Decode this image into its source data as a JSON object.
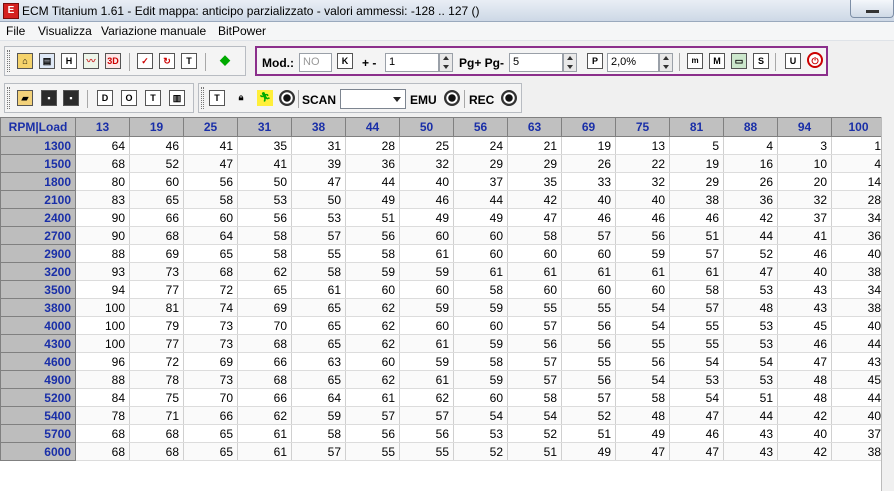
{
  "window": {
    "app_icon_label": "E",
    "title": "ECM Titanium 1.61 - Edit mappa: anticipo parzializzato - valori ammessi: -128 .. 127 ()"
  },
  "menu": [
    "File",
    "Visualizza",
    "Variazione manuale",
    "BitPower"
  ],
  "toolbar1": {
    "mod_label": "Mod.:",
    "mod_placeholder": "NO",
    "plusminus_label": "+ -",
    "step_value": "1",
    "page_label": "Pg+ Pg-",
    "page_value": "5",
    "percent_value": "2,0%"
  },
  "toolbar2": {
    "scan_label": "SCAN",
    "scan_value": "",
    "emu_label": "EMU",
    "rec_label": "REC"
  },
  "icons": {
    "t1_group_a": [
      "home-icon",
      "copy-windows-icon",
      "h-icon",
      "chart-icon",
      "3d-chart-icon"
    ],
    "t1_group_b": [
      "checklist-icon",
      "refresh-icon",
      "table-icon",
      "shapes-icon"
    ],
    "t1_group_c": [
      "k-icon"
    ],
    "t1_group_d": [
      "p-icon"
    ],
    "t1_group_e": [
      "m-small-icon",
      "m-icon",
      "monitor-icon",
      "s-icon",
      "u-icon",
      "power-icon"
    ],
    "t2_group_a": [
      "open-folder-icon",
      "save-icon",
      "save-as-icon",
      "d-icon",
      "o-icon",
      "t-icon",
      "split-icon"
    ],
    "t2_group_b": [
      "terminal-icon",
      "lock-icon",
      "run-icon",
      "record-dot-icon"
    ]
  },
  "grid": {
    "corner_label": "RPM|Load",
    "columns": [
      "13",
      "19",
      "25",
      "31",
      "38",
      "44",
      "50",
      "56",
      "63",
      "69",
      "75",
      "81",
      "88",
      "94",
      "100"
    ],
    "rows": [
      {
        "rpm": "1300",
        "values": [
          64,
          46,
          41,
          35,
          31,
          28,
          25,
          24,
          21,
          19,
          13,
          5,
          4,
          3,
          1
        ]
      },
      {
        "rpm": "1500",
        "values": [
          68,
          52,
          47,
          41,
          39,
          36,
          32,
          29,
          29,
          26,
          22,
          19,
          16,
          10,
          4
        ]
      },
      {
        "rpm": "1800",
        "values": [
          80,
          60,
          56,
          50,
          47,
          44,
          40,
          37,
          35,
          33,
          32,
          29,
          26,
          20,
          14
        ]
      },
      {
        "rpm": "2100",
        "values": [
          83,
          65,
          58,
          53,
          50,
          49,
          46,
          44,
          42,
          40,
          40,
          38,
          36,
          32,
          28
        ]
      },
      {
        "rpm": "2400",
        "values": [
          90,
          66,
          60,
          56,
          53,
          51,
          49,
          49,
          47,
          46,
          46,
          46,
          42,
          37,
          34
        ]
      },
      {
        "rpm": "2700",
        "values": [
          90,
          68,
          64,
          58,
          57,
          56,
          60,
          60,
          58,
          57,
          56,
          51,
          44,
          41,
          36
        ]
      },
      {
        "rpm": "2900",
        "values": [
          88,
          69,
          65,
          58,
          55,
          58,
          61,
          60,
          60,
          60,
          59,
          57,
          52,
          46,
          40
        ]
      },
      {
        "rpm": "3200",
        "values": [
          93,
          73,
          68,
          62,
          58,
          59,
          59,
          61,
          61,
          61,
          61,
          61,
          47,
          40,
          38
        ]
      },
      {
        "rpm": "3500",
        "values": [
          94,
          77,
          72,
          65,
          61,
          60,
          60,
          58,
          60,
          60,
          60,
          58,
          53,
          43,
          34
        ]
      },
      {
        "rpm": "3800",
        "values": [
          100,
          81,
          74,
          69,
          65,
          62,
          59,
          59,
          55,
          55,
          54,
          57,
          48,
          43,
          38
        ]
      },
      {
        "rpm": "4000",
        "values": [
          100,
          79,
          73,
          70,
          65,
          62,
          60,
          60,
          57,
          56,
          54,
          55,
          53,
          45,
          40
        ]
      },
      {
        "rpm": "4300",
        "values": [
          100,
          77,
          73,
          68,
          65,
          62,
          61,
          59,
          56,
          56,
          55,
          55,
          53,
          46,
          44
        ]
      },
      {
        "rpm": "4600",
        "values": [
          96,
          72,
          69,
          66,
          63,
          60,
          59,
          58,
          57,
          55,
          56,
          54,
          54,
          47,
          43
        ]
      },
      {
        "rpm": "4900",
        "values": [
          88,
          78,
          73,
          68,
          65,
          62,
          61,
          59,
          57,
          56,
          54,
          53,
          53,
          48,
          45
        ]
      },
      {
        "rpm": "5200",
        "values": [
          84,
          75,
          70,
          66,
          64,
          61,
          62,
          60,
          58,
          57,
          58,
          54,
          51,
          48,
          44
        ]
      },
      {
        "rpm": "5400",
        "values": [
          78,
          71,
          66,
          62,
          59,
          57,
          57,
          54,
          54,
          52,
          48,
          47,
          44,
          42,
          40
        ]
      },
      {
        "rpm": "5700",
        "values": [
          68,
          68,
          65,
          61,
          58,
          56,
          56,
          53,
          52,
          51,
          49,
          46,
          43,
          40,
          37
        ]
      },
      {
        "rpm": "6000",
        "values": [
          68,
          68,
          65,
          61,
          57,
          55,
          55,
          52,
          51,
          49,
          47,
          47,
          43,
          42,
          38
        ]
      }
    ]
  }
}
